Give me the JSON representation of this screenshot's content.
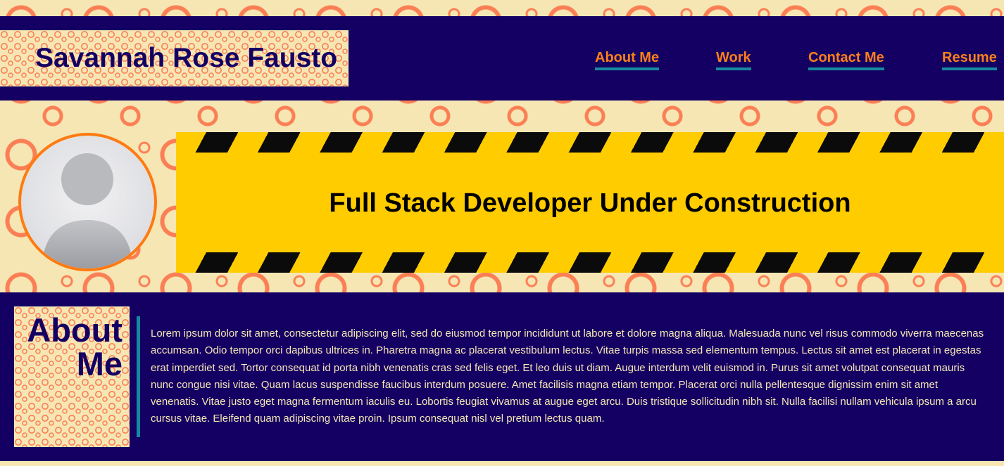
{
  "header": {
    "brand": "Savannah Rose Fausto",
    "nav": [
      {
        "label": "About Me"
      },
      {
        "label": "Work"
      },
      {
        "label": "Contact Me"
      },
      {
        "label": "Resume"
      }
    ]
  },
  "hero": {
    "avatar_icon": "user-silhouette-icon",
    "banner_text": "Full Stack Developer Under Construction"
  },
  "about": {
    "title": "About Me",
    "body": "Lorem ipsum dolor sit amet, consectetur adipiscing elit, sed do eiusmod tempor incididunt ut labore et dolore magna aliqua. Malesuada nunc vel risus commodo viverra maecenas accumsan. Odio tempor orci dapibus ultrices in. Pharetra magna ac placerat vestibulum lectus. Vitae turpis massa sed elementum tempus. Lectus sit amet est placerat in egestas erat imperdiet sed. Tortor consequat id porta nibh venenatis cras sed felis eget. Et leo duis ut diam. Augue interdum velit euismod in. Purus sit amet volutpat consequat mauris nunc congue nisi vitae. Quam lacus suspendisse faucibus interdum posuere. Amet facilisis magna etiam tempor. Placerat orci nulla pellentesque dignissim enim sit amet venenatis. Vitae justo eget magna fermentum iaculis eu. Lobortis feugiat vivamus at augue eget arcu. Duis tristique sollicitudin nibh sit. Nulla facilisi nullam vehicula ipsum a arcu cursus vitae. Eleifend quam adipiscing vitae proin. Ipsum consequat nisl vel pretium lectus quam."
  },
  "colors": {
    "navy": "#140063",
    "orange": "#fb7f1b",
    "teal": "#16899e",
    "cream": "#f6e6b4",
    "yellow": "#ffcc00"
  }
}
